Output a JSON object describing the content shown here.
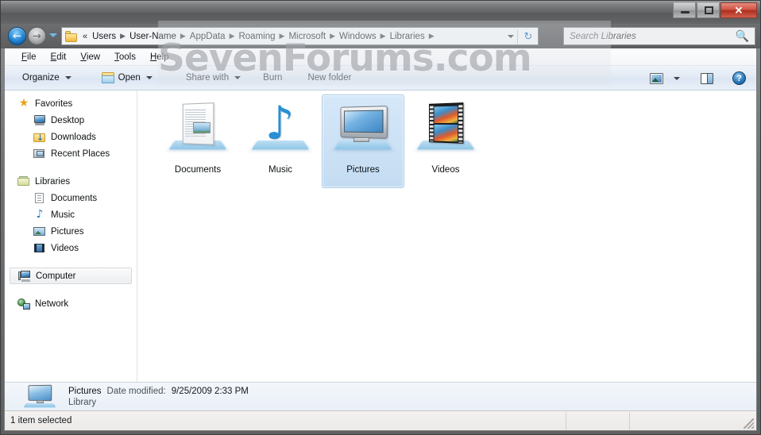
{
  "window": {
    "controls": {
      "minimize": "–",
      "maximize": "□",
      "close": "✕"
    }
  },
  "watermark": "SevenForums.com",
  "navigation": {
    "back_label": "←",
    "forward_label": "→",
    "history_dropdown": "chevron-down-icon",
    "refresh_label": "↻",
    "overflow": "«",
    "breadcrumbs": [
      {
        "label": "Users"
      },
      {
        "label": "User-Name"
      },
      {
        "label": "AppData"
      },
      {
        "label": "Roaming"
      },
      {
        "label": "Microsoft"
      },
      {
        "label": "Windows"
      },
      {
        "label": "Libraries"
      }
    ],
    "separator": "▶"
  },
  "search": {
    "placeholder": "Search Libraries",
    "value": "",
    "icon": "🔍"
  },
  "menubar": {
    "items": [
      {
        "accel": "F",
        "rest": "ile"
      },
      {
        "accel": "E",
        "rest": "dit"
      },
      {
        "accel": "V",
        "rest": "iew"
      },
      {
        "accel": "T",
        "rest": "ools"
      },
      {
        "accel": "H",
        "rest": "elp"
      }
    ]
  },
  "toolbar": {
    "organize_label": "Organize",
    "open_label": "Open",
    "share_with_label": "Share with",
    "burn_label": "Burn",
    "new_folder_label": "New folder",
    "change_view_label": "change-view-icon",
    "preview_pane_label": "preview-pane-icon",
    "help_label": "?"
  },
  "sidebar": {
    "groups": [
      {
        "label": "Favorites",
        "icon": "star-icon",
        "items": [
          {
            "label": "Desktop",
            "icon": "desktop-icon"
          },
          {
            "label": "Downloads",
            "icon": "downloads-icon"
          },
          {
            "label": "Recent Places",
            "icon": "recent-places-icon"
          }
        ]
      },
      {
        "label": "Libraries",
        "icon": "libraries-icon",
        "items": [
          {
            "label": "Documents",
            "icon": "document-icon"
          },
          {
            "label": "Music",
            "icon": "music-icon"
          },
          {
            "label": "Pictures",
            "icon": "pictures-icon"
          },
          {
            "label": "Videos",
            "icon": "videos-icon"
          }
        ]
      }
    ],
    "computer": {
      "label": "Computer",
      "icon": "computer-icon",
      "highlighted": true
    },
    "network": {
      "label": "Network",
      "icon": "network-icon"
    }
  },
  "content": {
    "tiles": [
      {
        "label": "Documents",
        "icon": "documents-library-icon",
        "selected": false
      },
      {
        "label": "Music",
        "icon": "music-library-icon",
        "selected": false
      },
      {
        "label": "Pictures",
        "icon": "pictures-library-icon",
        "selected": true
      },
      {
        "label": "Videos",
        "icon": "videos-library-icon",
        "selected": false
      }
    ]
  },
  "details": {
    "name": "Pictures",
    "date_modified_label": "Date modified:",
    "date_modified_value": "9/25/2009 2:33 PM",
    "type": "Library"
  },
  "statusbar": {
    "text": "1 item selected"
  },
  "colors": {
    "selection_fill": "#cde1f5",
    "selection_border": "#a8c8e4",
    "close_button": "#c0392b",
    "accent_blue": "#2e7fc4"
  }
}
